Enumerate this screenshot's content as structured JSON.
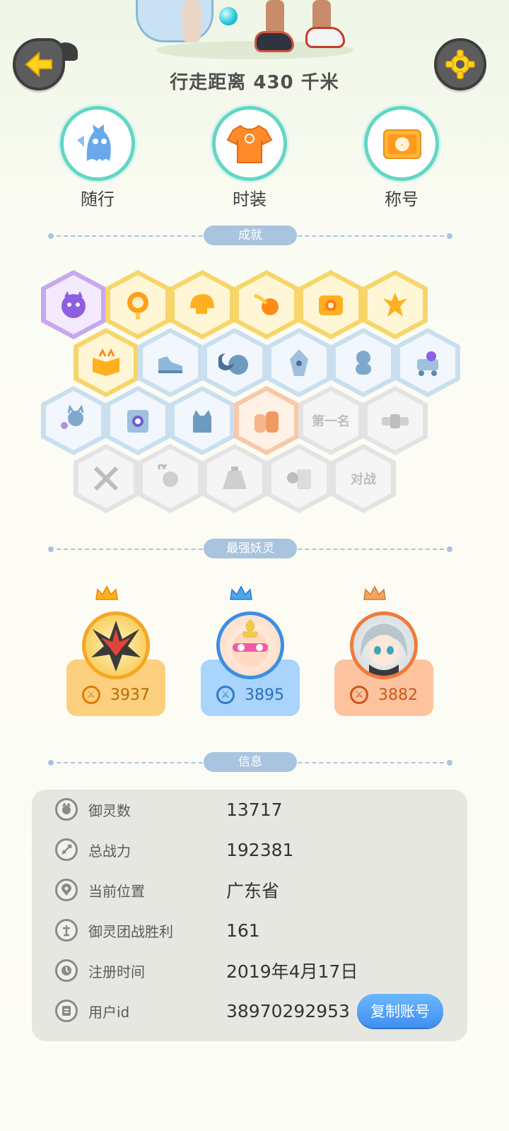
{
  "header": {
    "walk_distance": "行走距离 430 千米"
  },
  "top_menu": [
    {
      "label": "随行",
      "icon": "ghost-spirit-icon"
    },
    {
      "label": "时装",
      "icon": "tshirt-icon"
    },
    {
      "label": "称号",
      "icon": "title-card-icon"
    }
  ],
  "sections": {
    "achievements": "成就",
    "strongest": "最强妖灵",
    "info": "信息"
  },
  "achievements": {
    "badge_text_first_place": "第一名",
    "badge_text_battle": "对战"
  },
  "strongest_spirits": [
    {
      "power": "3937",
      "color": "#f5a623"
    },
    {
      "power": "3895",
      "color": "#3a8ee6"
    },
    {
      "power": "3882",
      "color": "#f07a3a"
    }
  ],
  "info": {
    "rows": [
      {
        "label": "御灵数",
        "value": "13717",
        "icon": "spirit-count-icon"
      },
      {
        "label": "总战力",
        "value": "192381",
        "icon": "sword-icon"
      },
      {
        "label": "当前位置",
        "value": "广东省",
        "icon": "location-pin-icon"
      },
      {
        "label": "御灵团战胜利",
        "value": "161",
        "icon": "trophy-icon"
      },
      {
        "label": "注册时间",
        "value": "2019年4月17日",
        "icon": "clock-icon"
      },
      {
        "label": "用户id",
        "value": "38970292953",
        "icon": "id-card-icon"
      }
    ],
    "copy_button": "复制账号"
  }
}
